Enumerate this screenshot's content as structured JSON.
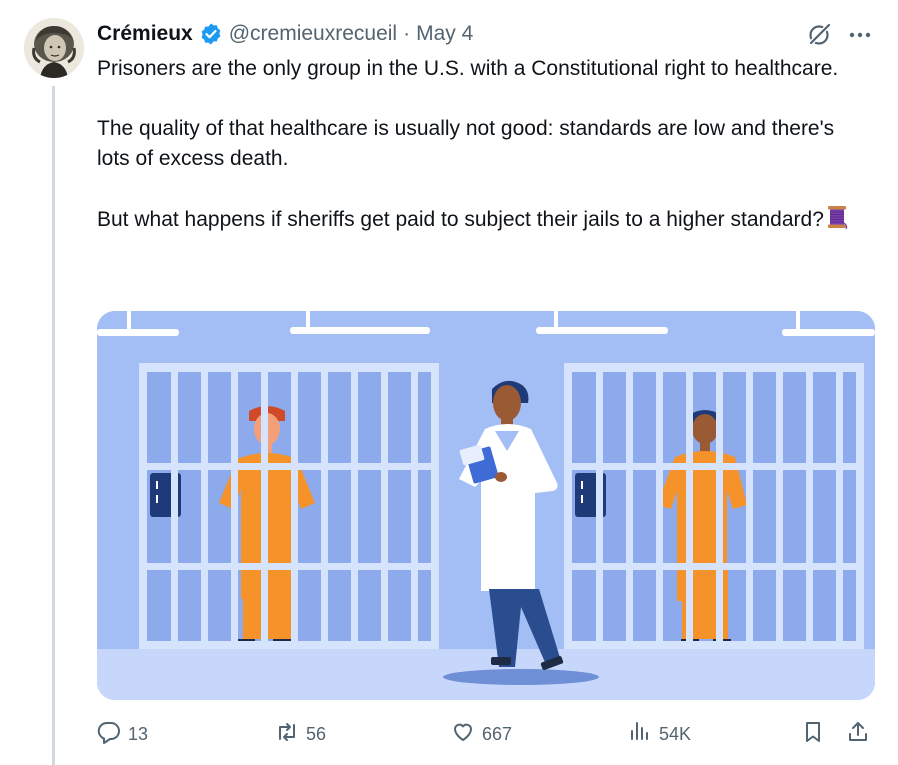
{
  "author": {
    "name": "Crémieux",
    "handle": "@cremieuxrecueil",
    "separator": "·",
    "date": "May 4"
  },
  "tweet": {
    "paragraphs": [
      "Prisoners are the only group in the U.S. with a Constitutional right to healthcare.",
      "The quality of that healthcare is usually not good: standards are low and there's lots of excess death.",
      "But what happens if sheriffs get paid to subject their jails to a higher standard?"
    ]
  },
  "icons": {
    "verified": "verified-badge-icon",
    "grok": "grok-icon",
    "more": "more-icon",
    "thread_emoji": "spool-of-thread-emoji",
    "reply": "reply-icon",
    "repost": "repost-icon",
    "like": "heart-icon",
    "views": "views-icon",
    "bookmark": "bookmark-icon",
    "share": "share-icon"
  },
  "actions": {
    "replies": "13",
    "reposts": "56",
    "likes": "667",
    "views": "54K"
  },
  "colors": {
    "verified": "#1d9bf0",
    "text": "#0f1419",
    "secondary": "#536471",
    "illustration_bg": "#a3bdf5",
    "prisoner_uniform": "#f5922a",
    "doctor_pants": "#2a4d8f"
  }
}
